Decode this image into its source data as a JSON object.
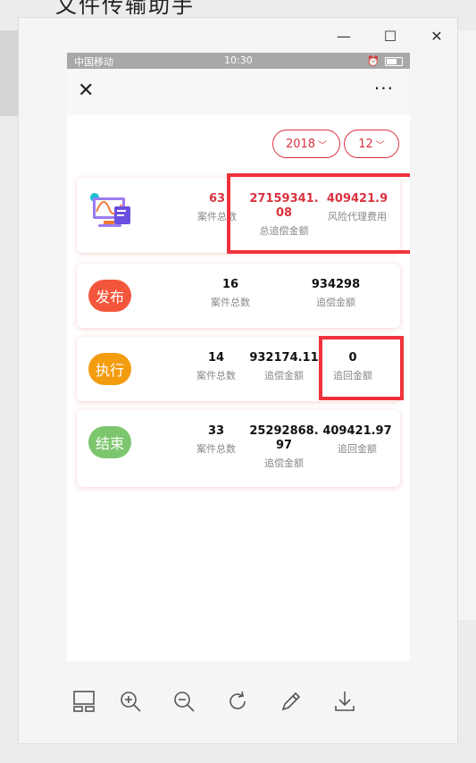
{
  "background": {
    "title": "文件传输助手"
  },
  "window": {
    "minimize": "—",
    "maximize": "☐",
    "close": "✕"
  },
  "phone": {
    "status": {
      "carrier": "中国移动",
      "time": "10:30"
    },
    "nav": {
      "close": "✕",
      "more": "···"
    },
    "filters": {
      "year": "2018",
      "month": "12"
    },
    "summary": {
      "cases": {
        "value": "63",
        "label": "案件总数"
      },
      "recovery": {
        "value": "27159341.08",
        "label": "总追偿金额"
      },
      "fee": {
        "value": "409421.9",
        "label": "风险代理费用"
      }
    },
    "published": {
      "badge": "发布",
      "cases": {
        "value": "16",
        "label": "案件总数"
      },
      "amount": {
        "value": "934298",
        "label": "追偿金额"
      }
    },
    "executing": {
      "badge": "执行",
      "cases": {
        "value": "14",
        "label": "案件总数"
      },
      "amount": {
        "value": "932174.11",
        "label": "追偿金额"
      },
      "recovered": {
        "value": "0",
        "label": "追回金额"
      }
    },
    "finished": {
      "badge": "结束",
      "cases": {
        "value": "33",
        "label": "案件总数"
      },
      "amount": {
        "value": "25292868.97",
        "label": "追偿金额"
      },
      "recovered": {
        "value": "409421.97",
        "label": "追回金额"
      }
    }
  },
  "toolbar": [
    "layout-icon",
    "zoom-in-icon",
    "zoom-out-icon",
    "rotate-icon",
    "edit-icon",
    "download-icon"
  ],
  "colors": {
    "accent": "#d9333f",
    "publish": "#f4563c",
    "execute": "#f39c0f",
    "finish": "#7cc66e",
    "highlight": "#f0323c"
  }
}
